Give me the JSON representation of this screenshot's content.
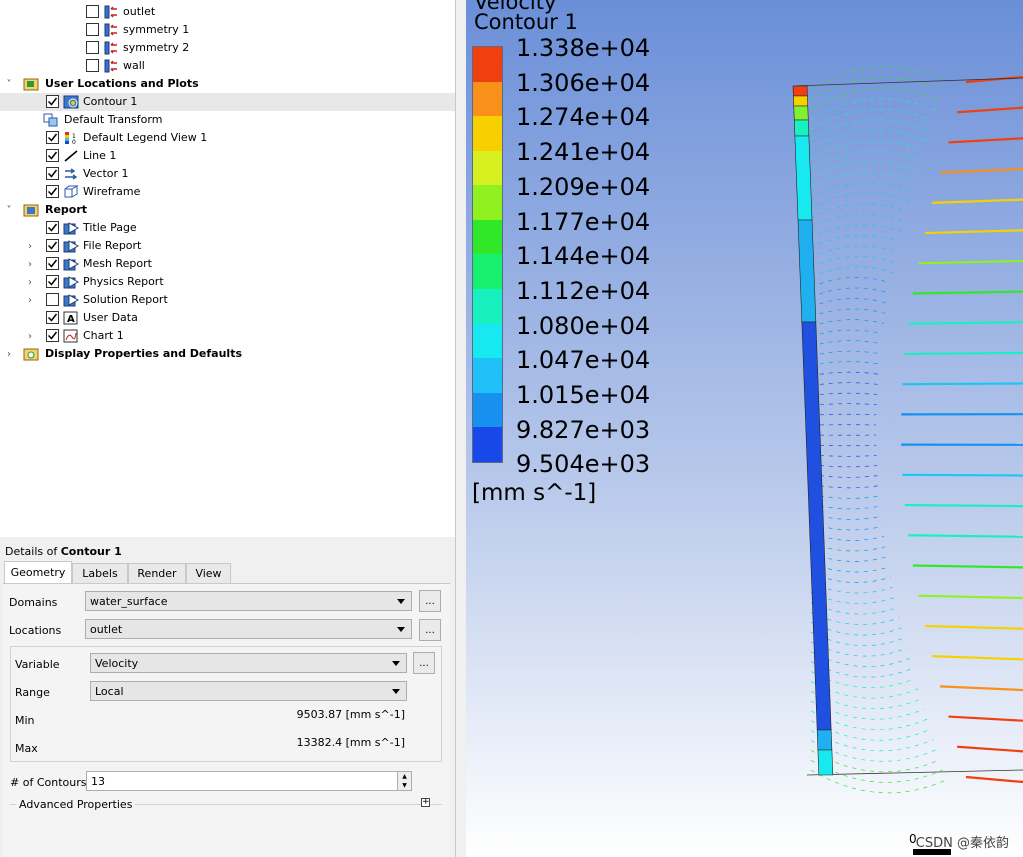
{
  "tree": {
    "rows": [
      {
        "label": "outlet",
        "checked": false,
        "icon": "boundary-icon"
      },
      {
        "label": "symmetry 1",
        "checked": false,
        "icon": "boundary-icon"
      },
      {
        "label": "symmetry 2",
        "checked": false,
        "icon": "boundary-icon"
      },
      {
        "label": "wall",
        "checked": false,
        "icon": "boundary-icon"
      },
      {
        "label": "User Locations and Plots",
        "icon": "folder-plots-icon",
        "bold": true
      },
      {
        "label": "Contour 1",
        "checked": true,
        "icon": "contour-icon",
        "selected": true
      },
      {
        "label": "Default Transform",
        "icon": "transform-icon"
      },
      {
        "label": "Default Legend View 1",
        "checked": true,
        "icon": "legend-icon"
      },
      {
        "label": "Line 1",
        "checked": true,
        "icon": "line-icon"
      },
      {
        "label": "Vector 1",
        "checked": true,
        "icon": "vector-icon"
      },
      {
        "label": "Wireframe",
        "checked": true,
        "icon": "wireframe-icon"
      },
      {
        "label": "Report",
        "icon": "report-folder-icon",
        "bold": true
      },
      {
        "label": "Title Page",
        "checked": true,
        "icon": "report-page-icon"
      },
      {
        "label": "File Report",
        "checked": true,
        "icon": "report-page-icon"
      },
      {
        "label": "Mesh Report",
        "checked": true,
        "icon": "report-page-icon"
      },
      {
        "label": "Physics Report",
        "checked": true,
        "icon": "report-page-icon"
      },
      {
        "label": "Solution Report",
        "checked": false,
        "icon": "report-page-icon"
      },
      {
        "label": "User Data",
        "checked": true,
        "icon": "user-data-icon"
      },
      {
        "label": "Chart 1",
        "checked": true,
        "icon": "chart-icon"
      },
      {
        "label": "Display Properties and Defaults",
        "icon": "display-properties-icon",
        "bold": true
      }
    ]
  },
  "details": {
    "header_prefix": "Details of ",
    "header_object": "Contour 1",
    "tabs": [
      "Geometry",
      "Labels",
      "Render",
      "View"
    ],
    "domains_label": "Domains",
    "domains_value": "water_surface",
    "locations_label": "Locations",
    "locations_value": "outlet",
    "variable_label": "Variable",
    "variable_value": "Velocity",
    "range_label": "Range",
    "range_value": "Local",
    "min_label": "Min",
    "min_value": "9503.87 [mm s^-1]",
    "max_label": "Max",
    "max_value": "13382.4 [mm s^-1]",
    "contours_label": "# of Contours",
    "contours_value": "13",
    "advanced_label": "Advanced Properties",
    "dots_label": "..."
  },
  "legend": {
    "title1": "Velocity",
    "title2": "Contour 1",
    "values": [
      "1.338e+04",
      "1.306e+04",
      "1.274e+04",
      "1.241e+04",
      "1.209e+04",
      "1.177e+04",
      "1.144e+04",
      "1.112e+04",
      "1.080e+04",
      "1.047e+04",
      "1.015e+04",
      "9.827e+03",
      "9.504e+03"
    ],
    "units": "[mm s^-1]",
    "colors": [
      "#f04010",
      "#f8901a",
      "#f8d000",
      "#d8f020",
      "#90f020",
      "#30e828",
      "#18f070",
      "#18f0c0",
      "#18e8f0",
      "#20c0f8",
      "#1890f0",
      "#1848e8"
    ]
  },
  "watermark": "CSDN @秦依韵",
  "scale_label": "0"
}
